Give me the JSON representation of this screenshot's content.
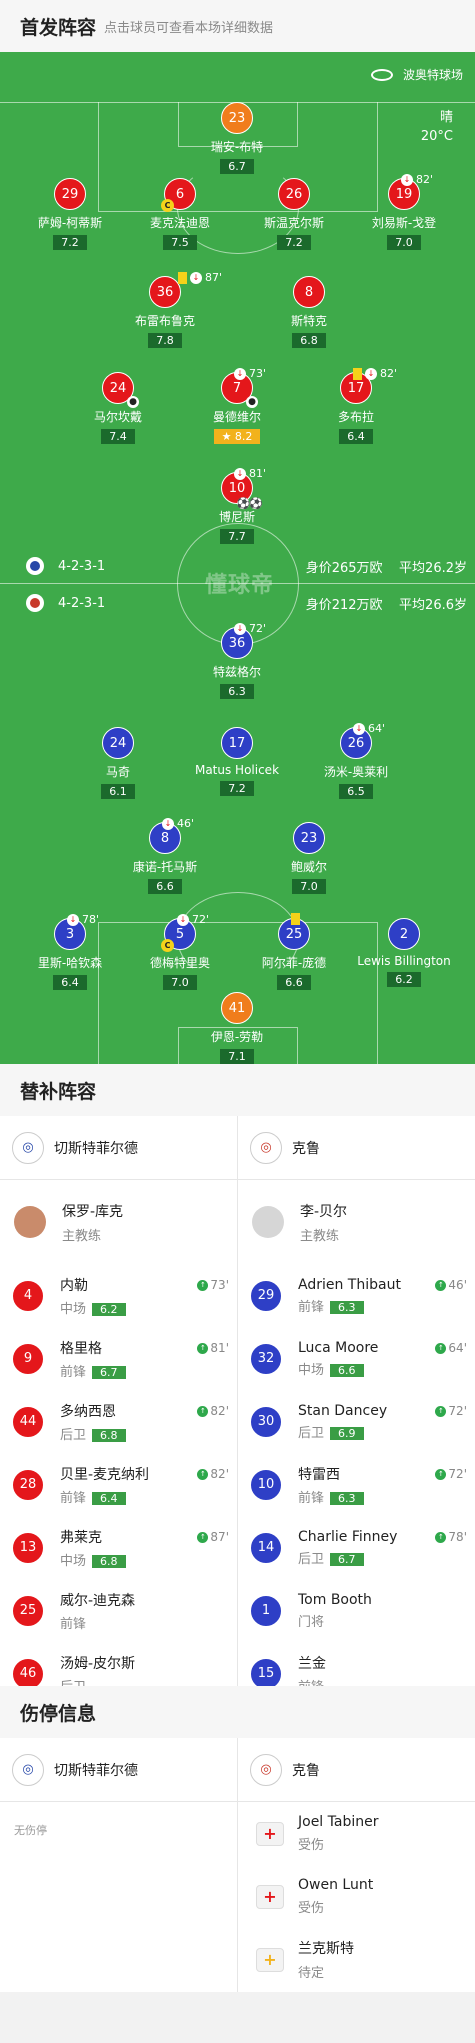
{
  "header": {
    "title": "首发阵容",
    "subtitle": "点击球员可查看本场详细数据"
  },
  "venue": "波奥特球场",
  "weather": {
    "cond": "晴",
    "temp": "20°C"
  },
  "watermark": "懂球帝",
  "home": {
    "formation": "4-2-3-1",
    "value": "身价265万欧",
    "age": "平均26.2岁"
  },
  "away": {
    "formation": "4-2-3-1",
    "value": "身价212万欧",
    "age": "平均26.6岁"
  },
  "home_players": [
    {
      "num": "23",
      "name": "瑞安-布特",
      "rating": "6.7"
    },
    {
      "num": "29",
      "name": "萨姆-柯蒂斯",
      "rating": "7.2"
    },
    {
      "num": "6",
      "name": "麦克法迪恩",
      "rating": "7.5"
    },
    {
      "num": "26",
      "name": "斯温克尔斯",
      "rating": "7.2"
    },
    {
      "num": "19",
      "name": "刘易斯-戈登",
      "rating": "7.0",
      "sub": "82'"
    },
    {
      "num": "36",
      "name": "布雷布鲁克",
      "rating": "7.8",
      "sub": "87'"
    },
    {
      "num": "8",
      "name": "斯特克",
      "rating": "6.8"
    },
    {
      "num": "24",
      "name": "马尔坎戴",
      "rating": "7.4"
    },
    {
      "num": "7",
      "name": "曼德维尔",
      "rating": "8.2",
      "sub": "73'"
    },
    {
      "num": "17",
      "name": "多布拉",
      "rating": "6.4",
      "sub": "82'"
    },
    {
      "num": "10",
      "name": "博尼斯",
      "rating": "7.7",
      "sub": "81'"
    }
  ],
  "away_players": [
    {
      "num": "36",
      "name": "特兹格尔",
      "rating": "6.3",
      "sub": "72'"
    },
    {
      "num": "24",
      "name": "马奇",
      "rating": "6.1"
    },
    {
      "num": "17",
      "name": "Matus Holicek",
      "rating": "7.2"
    },
    {
      "num": "26",
      "name": "汤米-奥莱利",
      "rating": "6.5",
      "sub": "64'"
    },
    {
      "num": "8",
      "name": "康诺-托马斯",
      "rating": "6.6",
      "sub": "46'"
    },
    {
      "num": "23",
      "name": "鲍威尔",
      "rating": "7.0"
    },
    {
      "num": "3",
      "name": "里斯-哈钦森",
      "rating": "6.4",
      "sub": "78'"
    },
    {
      "num": "5",
      "name": "德梅特里奥",
      "rating": "7.0",
      "sub": "72'"
    },
    {
      "num": "25",
      "name": "阿尔菲-庞德",
      "rating": "6.6"
    },
    {
      "num": "2",
      "name": "Lewis Billington",
      "rating": "6.2"
    },
    {
      "num": "41",
      "name": "伊恩-劳勒",
      "rating": "7.1"
    }
  ],
  "subs_title": "替补阵容",
  "home_team": "切斯特菲尔德",
  "away_team": "克鲁",
  "home_coach": {
    "name": "保罗-库克",
    "role": "主教练"
  },
  "away_coach": {
    "name": "李-贝尔",
    "role": "主教练"
  },
  "home_subs": [
    {
      "num": "4",
      "name": "内勒",
      "pos": "中场",
      "rating": "6.2",
      "min": "73'"
    },
    {
      "num": "9",
      "name": "格里格",
      "pos": "前锋",
      "rating": "6.7",
      "min": "81'"
    },
    {
      "num": "44",
      "name": "多纳西恩",
      "pos": "后卫",
      "rating": "6.8",
      "min": "82'"
    },
    {
      "num": "28",
      "name": "贝里-麦克纳利",
      "pos": "前锋",
      "rating": "6.4",
      "min": "82'"
    },
    {
      "num": "13",
      "name": "弗莱克",
      "pos": "中场",
      "rating": "6.8",
      "min": "87'"
    },
    {
      "num": "25",
      "name": "威尔-迪克森",
      "pos": "前锋"
    },
    {
      "num": "46",
      "name": "汤姆-皮尔斯",
      "pos": "后卫"
    }
  ],
  "away_subs": [
    {
      "num": "29",
      "name": "Adrien Thibaut",
      "pos": "前锋",
      "rating": "6.3",
      "min": "46'"
    },
    {
      "num": "32",
      "name": "Luca Moore",
      "pos": "中场",
      "rating": "6.6",
      "min": "64'"
    },
    {
      "num": "30",
      "name": "Stan Dancey",
      "pos": "后卫",
      "rating": "6.9",
      "min": "72'"
    },
    {
      "num": "10",
      "name": "特雷西",
      "pos": "前锋",
      "rating": "6.3",
      "min": "72'"
    },
    {
      "num": "14",
      "name": "Charlie Finney",
      "pos": "后卫",
      "rating": "6.7",
      "min": "78'"
    },
    {
      "num": "1",
      "name": "Tom Booth",
      "pos": "门将"
    },
    {
      "num": "15",
      "name": "兰金",
      "pos": "前锋"
    }
  ],
  "injury_title": "伤停信息",
  "home_injury_none": "无伤停",
  "away_injuries": [
    {
      "name": "Joel Tabiner",
      "status": "受伤"
    },
    {
      "name": "Owen Lunt",
      "status": "受伤"
    },
    {
      "name": "兰克斯特",
      "status": "待定"
    }
  ],
  "colors": {
    "pitch": "#3eaa4a",
    "home": "#e4171b",
    "away": "#2e3fc6",
    "keeper": "#f07d1c"
  }
}
